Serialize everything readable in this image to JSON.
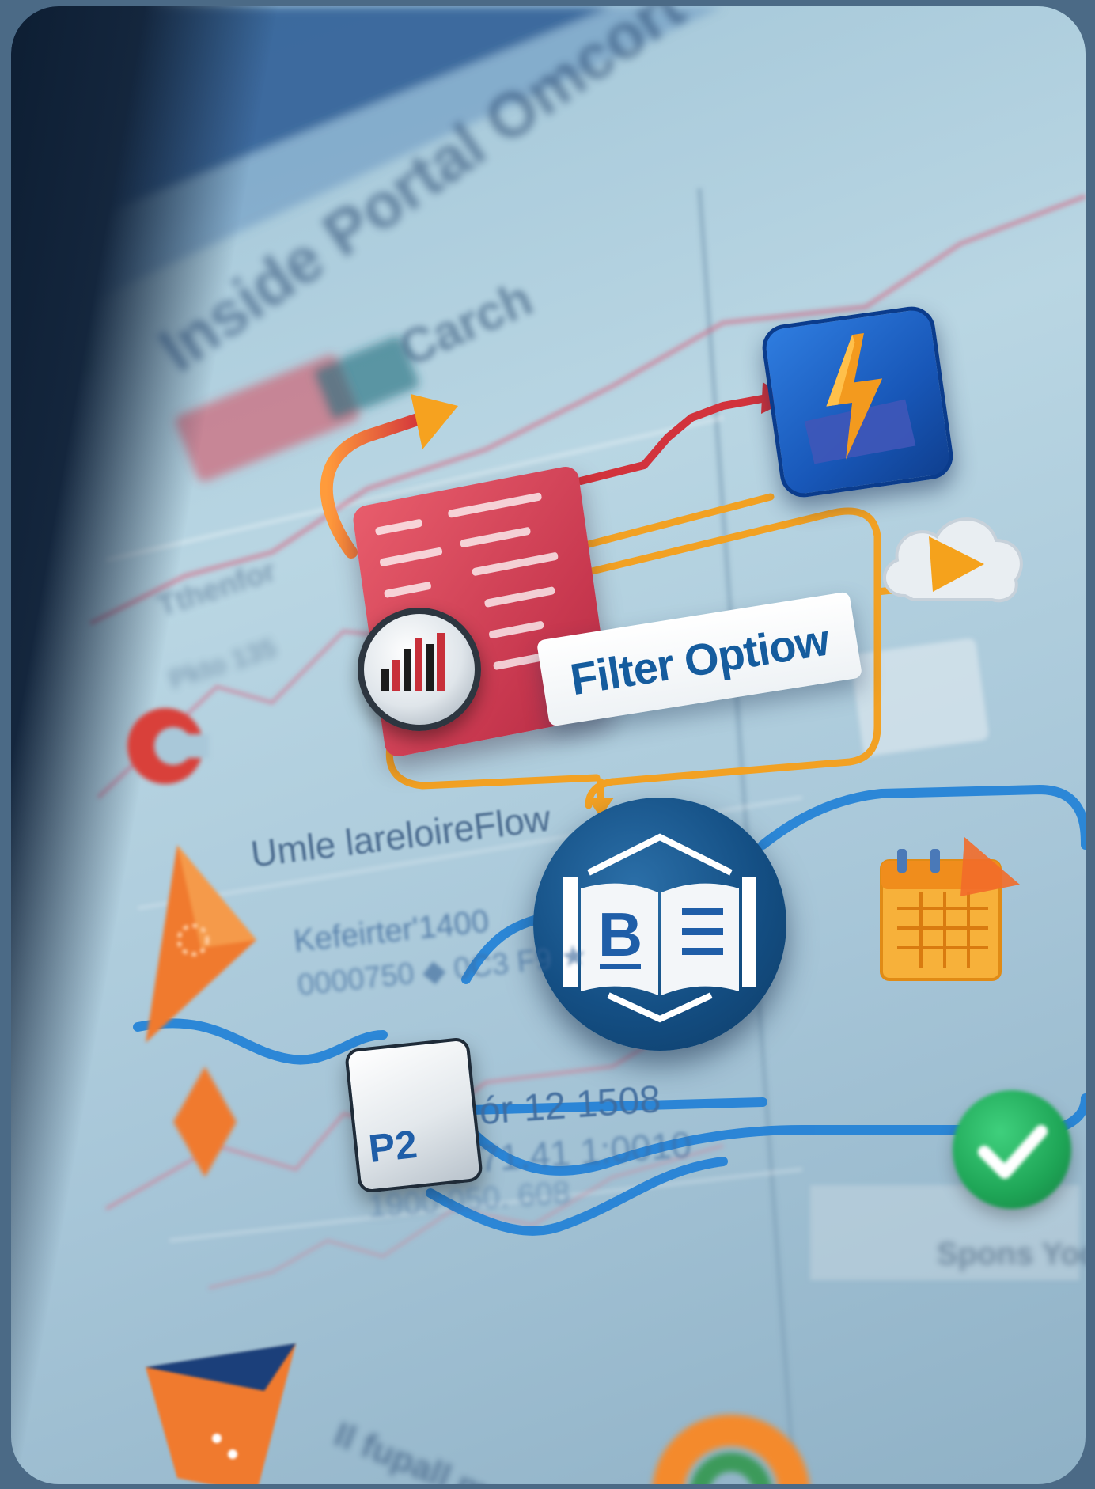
{
  "background_texts": {
    "title": "Inside Portal Omcort",
    "search": "Carch",
    "row1": "Tthenfor",
    "row2": "Pkto 135"
  },
  "flow_label": "Umle lareloireFlow",
  "keyframe": {
    "value": "Kefeirter'1400",
    "code": "0000750 ◆ 0C3 F9 ★"
  },
  "references": [
    "ór 12 1508",
    "71.41 1:0010",
    "1900 050. 608"
  ],
  "filter_option": {
    "label": "Filter Optiow"
  },
  "p2_label": "P2",
  "book_letter": "B",
  "bottom_label": "Il fupall mnefiant",
  "status_label": "Spons Yod",
  "colors": {
    "accent_blue": "#1e6fc9",
    "flow_orange": "#f2a123",
    "arrow_red": "#d2333c",
    "card_red": "#c8384f",
    "check_green": "#1ea556"
  },
  "icons": [
    "bolt-icon",
    "chart-icon",
    "book-icon",
    "play-icon",
    "calendar-icon",
    "check-icon"
  ]
}
